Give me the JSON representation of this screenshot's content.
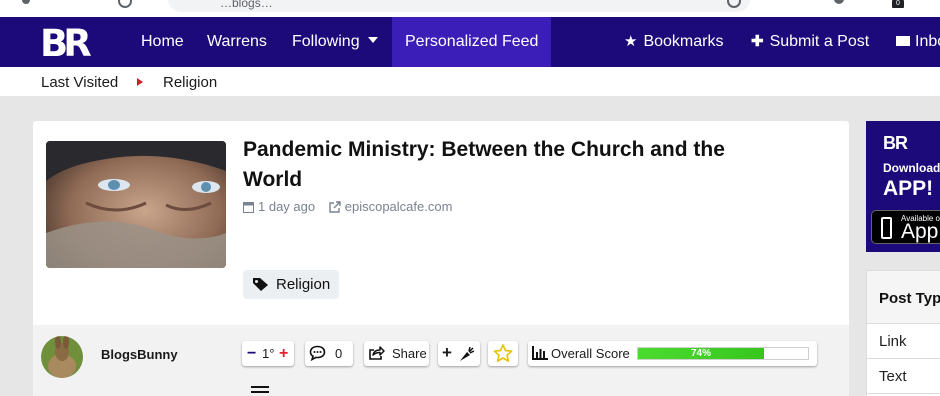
{
  "browser": {
    "address_text": "…blogs…"
  },
  "nav": {
    "items": [
      "Home",
      "Warrens",
      "Following",
      "Personalized Feed"
    ],
    "bookmarks": "Bookmarks",
    "submit": "Submit a Post",
    "inbox": "Inbox",
    "accent": "#1c0a7a",
    "active_bg": "#3b1db8"
  },
  "breadcrumb": {
    "items": [
      "Last Visited",
      "Religion"
    ]
  },
  "post": {
    "title": "Pandemic Ministry: Between the Church and the World",
    "time": "1 day ago",
    "source": "episcopalcafe.com",
    "tag": "Religion",
    "author": "BlogsBunny",
    "votes": "1°",
    "comments": "0",
    "share_label": "Share",
    "score_label": "Overall Score",
    "score_value": "74%",
    "score_fraction": 0.74
  },
  "sidebar": {
    "ad_brand": "BR",
    "ad_line1": "Download",
    "ad_line2": "APP!",
    "ad_store_small": "Available on the",
    "ad_store_big": "App Store",
    "filter_title": "Post Type",
    "filter_options": [
      "Link",
      "Text"
    ]
  }
}
